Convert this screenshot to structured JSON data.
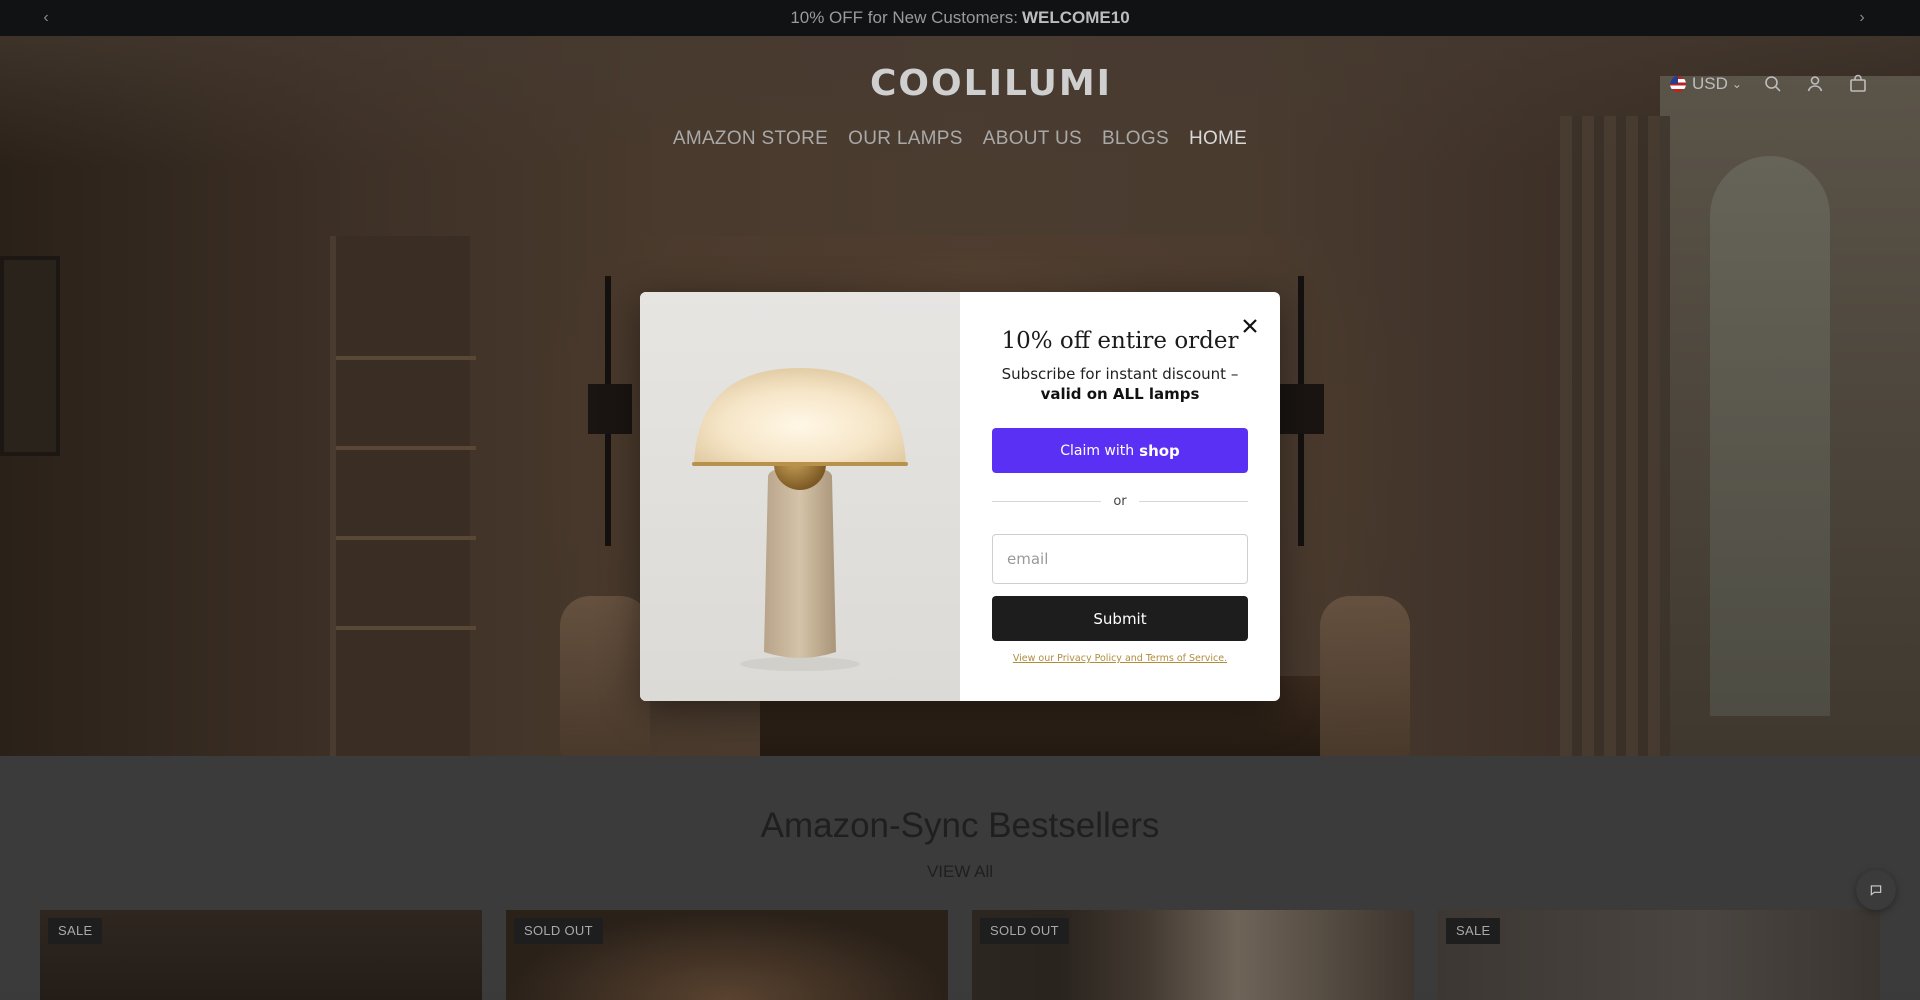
{
  "announcement": {
    "text": "10% OFF for New Customers:",
    "code": "WELCOME10",
    "prev_icon": "chevron-left-icon",
    "next_icon": "chevron-right-icon"
  },
  "header": {
    "logo": "COOLILUMI",
    "currency": "USD",
    "icons": [
      "search-icon",
      "account-icon",
      "cart-icon"
    ]
  },
  "nav": {
    "items": [
      "AMAZON STORE",
      "OUR LAMPS",
      "ABOUT US",
      "BLOGS",
      "HOME"
    ]
  },
  "section": {
    "title": "Amazon-Sync Bestsellers",
    "view_all": "VIEW All",
    "cards": [
      {
        "badge": "SALE"
      },
      {
        "badge": "SOLD OUT"
      },
      {
        "badge": "SOLD OUT"
      },
      {
        "badge": "SALE"
      }
    ]
  },
  "popup": {
    "title": "10% off entire order",
    "subtitle_prefix": "Subscribe for instant discount –",
    "subtitle_bold": "valid on ALL lamps",
    "shop_button_prefix": "Claim with",
    "shop_button_brand": "shop",
    "divider": "or",
    "email_placeholder": "email",
    "submit": "Submit",
    "privacy": "View our Privacy Policy and Terms of Service."
  },
  "colors": {
    "shop_purple": "#5a31f4",
    "privacy_gold": "#b08d3c",
    "announcement_bg": "#111214"
  }
}
